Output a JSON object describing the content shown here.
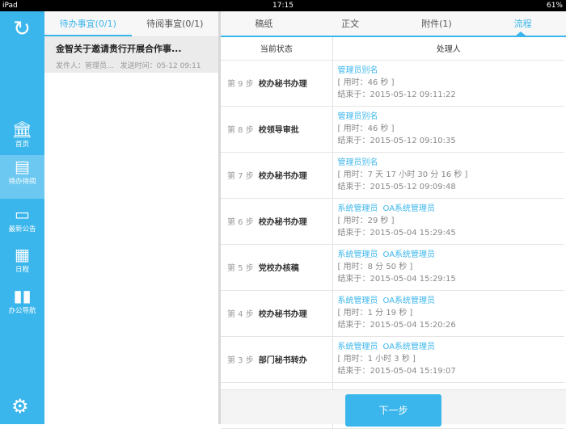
{
  "status": {
    "device": "iPad",
    "time": "17:15",
    "battery": "61%"
  },
  "sidebar": {
    "items": [
      {
        "label": "首页",
        "icon": "bank-icon"
      },
      {
        "label": "待办待阅",
        "icon": "board-icon"
      },
      {
        "label": "最新公告",
        "icon": "card-icon"
      },
      {
        "label": "日程",
        "icon": "calendar-icon"
      },
      {
        "label": "办公导航",
        "icon": "book-icon"
      }
    ]
  },
  "list": {
    "tabs": [
      "待办事宜(0/1)",
      "待阅事宜(0/1)"
    ],
    "items": [
      {
        "title": "金智关于邀请贵行开展合作事...",
        "sender": "发件人：管理员...",
        "time": "发送时间：05-12 09:11"
      }
    ]
  },
  "detail": {
    "tabs": [
      "稿纸",
      "正文",
      "附件(1)",
      "流程"
    ],
    "headers": [
      "当前状态",
      "处理人"
    ],
    "rows": [
      {
        "step": "第 9 步",
        "status": "校办秘书办理",
        "people": [
          "管理员别名"
        ],
        "duration": "[ 用时：46 秒 ]",
        "end": "结束于：2015-05-12 09:11:22"
      },
      {
        "step": "第 8 步",
        "status": "校领导审批",
        "people": [
          "管理员别名"
        ],
        "duration": "[ 用时：46 秒 ]",
        "end": "结束于：2015-05-12 09:10:35"
      },
      {
        "step": "第 7 步",
        "status": "校办秘书办理",
        "people": [
          "管理员别名"
        ],
        "duration": "[ 用时：7 天 17 小时 30 分 16 秒 ]",
        "end": "结束于：2015-05-12 09:09:48"
      },
      {
        "step": "第 6 步",
        "status": "校办秘书办理",
        "people": [
          "系统管理员",
          "OA系统管理员"
        ],
        "duration": "[ 用时：29 秒 ]",
        "end": "结束于：2015-05-04 15:29:45"
      },
      {
        "step": "第 5 步",
        "status": "党校办核稿",
        "people": [
          "系统管理员",
          "OA系统管理员"
        ],
        "duration": "[ 用时：8 分 50 秒 ]",
        "end": "结束于：2015-05-04 15:29:15"
      },
      {
        "step": "第 4 步",
        "status": "校办秘书办理",
        "people": [
          "系统管理员",
          "OA系统管理员"
        ],
        "duration": "[ 用时：1 分 19 秒 ]",
        "end": "结束于：2015-05-04 15:20:26"
      },
      {
        "step": "第 3 步",
        "status": "部门秘书转办",
        "people": [
          "系统管理员",
          "OA系统管理员"
        ],
        "duration": "[ 用时：1 小时 3 秒 ]",
        "end": "结束于：2015-05-04 15:19:07"
      }
    ],
    "next_label": "下一步"
  }
}
